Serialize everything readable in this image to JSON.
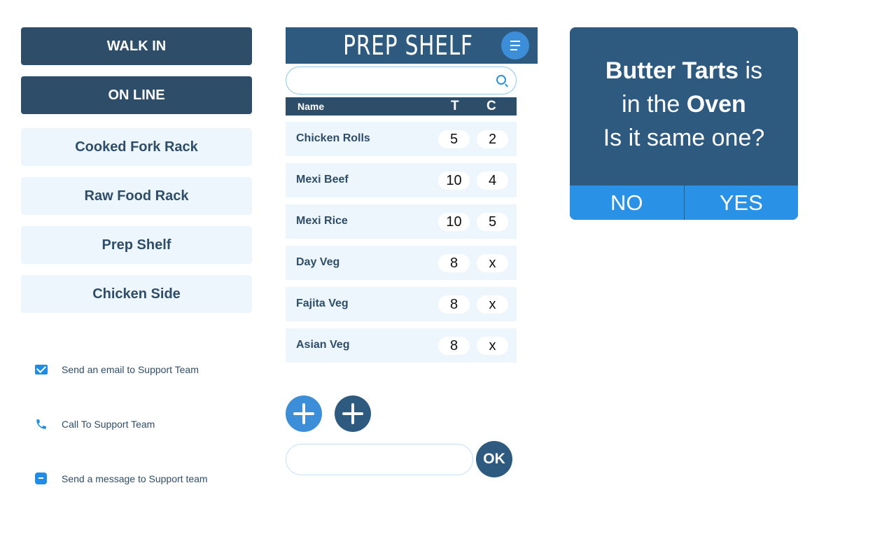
{
  "left": {
    "mode_buttons": [
      "WALK IN",
      "ON LINE"
    ],
    "racks": [
      "Cooked Fork Rack",
      "Raw Food Rack",
      "Prep Shelf",
      "Chicken Side"
    ],
    "support": {
      "email": "Send an email to Support Team",
      "phone": "Call To Support Team",
      "message": "Send a message to Support team"
    }
  },
  "shelf": {
    "title": "PREP SHELF",
    "search_value": "",
    "columns": {
      "name": "Name",
      "t": "T",
      "c": "C"
    },
    "rows": [
      {
        "name": "Chicken Rolls",
        "t": "5",
        "c": "2"
      },
      {
        "name": "Mexi Beef",
        "t": "10",
        "c": "4"
      },
      {
        "name": "Mexi Rice",
        "t": "10",
        "c": "5"
      },
      {
        "name": "Day Veg",
        "t": "8",
        "c": "x"
      },
      {
        "name": "Fajita Veg",
        "t": "8",
        "c": "x"
      },
      {
        "name": "Asian Veg",
        "t": "8",
        "c": "x"
      }
    ],
    "input_value": "",
    "ok_label": "OK"
  },
  "dialog": {
    "item": "Butter Tarts",
    "is_text": "is",
    "in_the": "in the",
    "location": "Oven",
    "question": "Is it same one?",
    "no_label": "NO",
    "yes_label": "YES"
  },
  "colors": {
    "dark_navy": "#2e4d68",
    "header_blue": "#2e5a80",
    "accent_blue": "#2a92e6",
    "light_row": "#eef6fd"
  }
}
